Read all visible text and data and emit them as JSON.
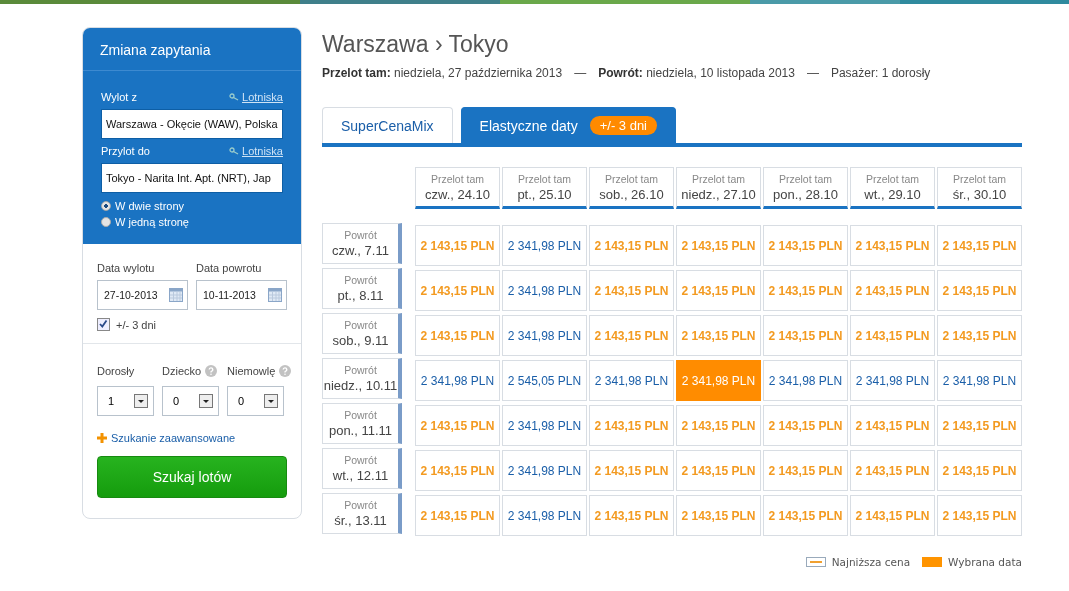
{
  "sidebar": {
    "title": "Zmiana zapytania",
    "from": {
      "label": "Wylot z",
      "link": "Lotniska",
      "value": "Warszawa - Okęcie (WAW), Polska"
    },
    "to": {
      "label": "Przylot do",
      "link": "Lotniska",
      "value": "Tokyo - Narita Int. Apt. (NRT), Jap"
    },
    "trip_types": [
      {
        "label": "W dwie strony",
        "selected": true
      },
      {
        "label": "W jedną stronę",
        "selected": false
      }
    ],
    "dates": [
      {
        "label": "Data wylotu",
        "value": "27-10-2013"
      },
      {
        "label": "Data powrotu",
        "value": "10-11-2013"
      }
    ],
    "flexible": {
      "label": "+/- 3 dni",
      "checked": true
    },
    "passengers": [
      {
        "label": "Dorosły",
        "value": "1",
        "help": false
      },
      {
        "label": "Dziecko",
        "value": "0",
        "help": true
      },
      {
        "label": "Niemowlę",
        "value": "0",
        "help": true
      }
    ],
    "advanced_link": "Szukanie zaawansowane",
    "search_button": "Szukaj lotów"
  },
  "heading": {
    "title": "Warszawa › Tokyo",
    "outbound_label": "Przelot tam:",
    "outbound": "niedziela, 27 października 2013",
    "return_label": "Powrót:",
    "return": "niedziela, 10 listopada 2013",
    "passengers": "Pasażer: 1 dorosły",
    "separator": "—"
  },
  "tabs": [
    {
      "label": "SuperCenaMix",
      "selected": false
    },
    {
      "label": "Elastyczne daty",
      "badge": "+/- 3 dni",
      "selected": true
    }
  ],
  "grid": {
    "columns": [
      {
        "caption": "Przelot tam",
        "date": "czw., 24.10"
      },
      {
        "caption": "Przelot tam",
        "date": "pt., 25.10"
      },
      {
        "caption": "Przelot tam",
        "date": "sob., 26.10"
      },
      {
        "caption": "Przelot tam",
        "date": "niedz., 27.10"
      },
      {
        "caption": "Przelot tam",
        "date": "pon., 28.10"
      },
      {
        "caption": "Przelot tam",
        "date": "wt., 29.10"
      },
      {
        "caption": "Przelot tam",
        "date": "śr., 30.10"
      }
    ],
    "rows": [
      {
        "caption": "Powrót",
        "date": "czw., 7.11",
        "cells": [
          {
            "price": "2 143,15 PLN",
            "lowest": true,
            "selected": false
          },
          {
            "price": "2 341,98 PLN",
            "lowest": false,
            "selected": false
          },
          {
            "price": "2 143,15 PLN",
            "lowest": true,
            "selected": false
          },
          {
            "price": "2 143,15 PLN",
            "lowest": true,
            "selected": false
          },
          {
            "price": "2 143,15 PLN",
            "lowest": true,
            "selected": false
          },
          {
            "price": "2 143,15 PLN",
            "lowest": true,
            "selected": false
          },
          {
            "price": "2 143,15 PLN",
            "lowest": true,
            "selected": false
          }
        ]
      },
      {
        "caption": "Powrót",
        "date": "pt., 8.11",
        "cells": [
          {
            "price": "2 143,15 PLN",
            "lowest": true,
            "selected": false
          },
          {
            "price": "2 341,98 PLN",
            "lowest": false,
            "selected": false
          },
          {
            "price": "2 143,15 PLN",
            "lowest": true,
            "selected": false
          },
          {
            "price": "2 143,15 PLN",
            "lowest": true,
            "selected": false
          },
          {
            "price": "2 143,15 PLN",
            "lowest": true,
            "selected": false
          },
          {
            "price": "2 143,15 PLN",
            "lowest": true,
            "selected": false
          },
          {
            "price": "2 143,15 PLN",
            "lowest": true,
            "selected": false
          }
        ]
      },
      {
        "caption": "Powrót",
        "date": "sob., 9.11",
        "cells": [
          {
            "price": "2 143,15 PLN",
            "lowest": true,
            "selected": false
          },
          {
            "price": "2 341,98 PLN",
            "lowest": false,
            "selected": false
          },
          {
            "price": "2 143,15 PLN",
            "lowest": true,
            "selected": false
          },
          {
            "price": "2 143,15 PLN",
            "lowest": true,
            "selected": false
          },
          {
            "price": "2 143,15 PLN",
            "lowest": true,
            "selected": false
          },
          {
            "price": "2 143,15 PLN",
            "lowest": true,
            "selected": false
          },
          {
            "price": "2 143,15 PLN",
            "lowest": true,
            "selected": false
          }
        ]
      },
      {
        "caption": "Powrót",
        "date": "niedz., 10.11",
        "cells": [
          {
            "price": "2 341,98 PLN",
            "lowest": false,
            "selected": false
          },
          {
            "price": "2 545,05 PLN",
            "lowest": false,
            "selected": false
          },
          {
            "price": "2 341,98 PLN",
            "lowest": false,
            "selected": false
          },
          {
            "price": "2 341,98 PLN",
            "lowest": false,
            "selected": true
          },
          {
            "price": "2 341,98 PLN",
            "lowest": false,
            "selected": false
          },
          {
            "price": "2 341,98 PLN",
            "lowest": false,
            "selected": false
          },
          {
            "price": "2 341,98 PLN",
            "lowest": false,
            "selected": false
          }
        ]
      },
      {
        "caption": "Powrót",
        "date": "pon., 11.11",
        "cells": [
          {
            "price": "2 143,15 PLN",
            "lowest": true,
            "selected": false
          },
          {
            "price": "2 341,98 PLN",
            "lowest": false,
            "selected": false
          },
          {
            "price": "2 143,15 PLN",
            "lowest": true,
            "selected": false
          },
          {
            "price": "2 143,15 PLN",
            "lowest": true,
            "selected": false
          },
          {
            "price": "2 143,15 PLN",
            "lowest": true,
            "selected": false
          },
          {
            "price": "2 143,15 PLN",
            "lowest": true,
            "selected": false
          },
          {
            "price": "2 143,15 PLN",
            "lowest": true,
            "selected": false
          }
        ]
      },
      {
        "caption": "Powrót",
        "date": "wt., 12.11",
        "cells": [
          {
            "price": "2 143,15 PLN",
            "lowest": true,
            "selected": false
          },
          {
            "price": "2 341,98 PLN",
            "lowest": false,
            "selected": false
          },
          {
            "price": "2 143,15 PLN",
            "lowest": true,
            "selected": false
          },
          {
            "price": "2 143,15 PLN",
            "lowest": true,
            "selected": false
          },
          {
            "price": "2 143,15 PLN",
            "lowest": true,
            "selected": false
          },
          {
            "price": "2 143,15 PLN",
            "lowest": true,
            "selected": false
          },
          {
            "price": "2 143,15 PLN",
            "lowest": true,
            "selected": false
          }
        ]
      },
      {
        "caption": "Powrót",
        "date": "śr., 13.11",
        "cells": [
          {
            "price": "2 143,15 PLN",
            "lowest": true,
            "selected": false
          },
          {
            "price": "2 341,98 PLN",
            "lowest": false,
            "selected": false
          },
          {
            "price": "2 143,15 PLN",
            "lowest": true,
            "selected": false
          },
          {
            "price": "2 143,15 PLN",
            "lowest": true,
            "selected": false
          },
          {
            "price": "2 143,15 PLN",
            "lowest": true,
            "selected": false
          },
          {
            "price": "2 143,15 PLN",
            "lowest": true,
            "selected": false
          },
          {
            "price": "2 143,15 PLN",
            "lowest": true,
            "selected": false
          }
        ]
      }
    ]
  },
  "legend": [
    {
      "kind": "lowest",
      "label": "Najniższa cena"
    },
    {
      "kind": "selected",
      "label": "Wybrana data"
    }
  ]
}
